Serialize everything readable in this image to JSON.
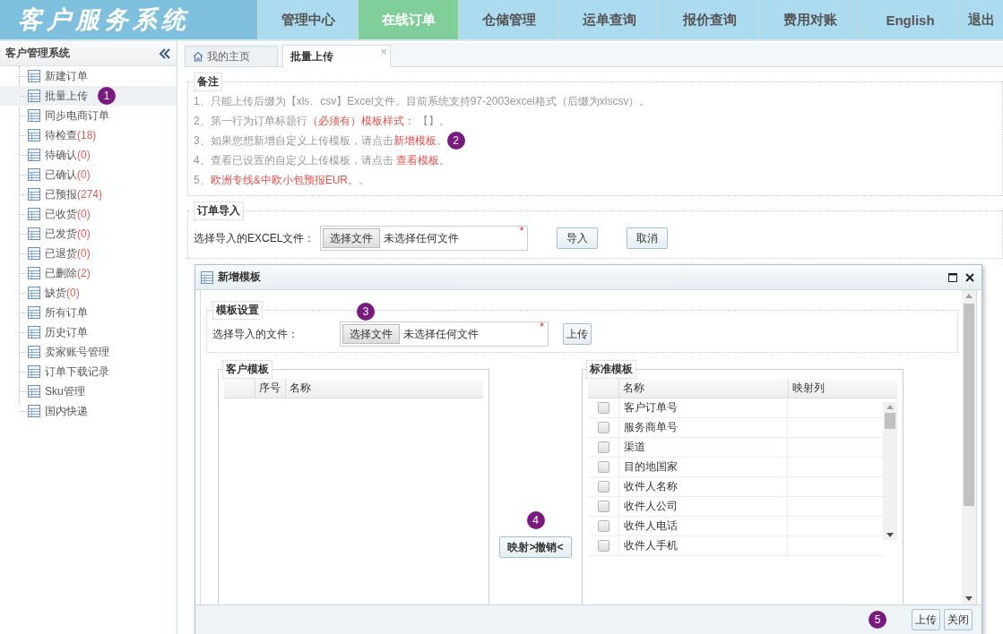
{
  "header": {
    "logo": "客户服务系统",
    "nav": [
      {
        "label": "管理中心",
        "selected": false
      },
      {
        "label": "在线订单",
        "selected": true
      },
      {
        "label": "仓储管理",
        "selected": false
      },
      {
        "label": "运单查询",
        "selected": false
      },
      {
        "label": "报价查询",
        "selected": false
      },
      {
        "label": "费用对账",
        "selected": false
      },
      {
        "label": "English",
        "selected": false
      },
      {
        "label": "退出",
        "selected": false
      }
    ]
  },
  "sidebar": {
    "title": "客户管理系统",
    "items": [
      {
        "label": "新建订单",
        "selected": false
      },
      {
        "label": "批量上传",
        "selected": true,
        "marker": "1"
      },
      {
        "label": "同步电商订单",
        "selected": false
      },
      {
        "label": "待检查",
        "count": "(18)",
        "selected": false
      },
      {
        "label": "待确认",
        "count": "(0)",
        "selected": false
      },
      {
        "label": "已确认",
        "count": "(0)",
        "selected": false
      },
      {
        "label": "已预报",
        "count": "(274)",
        "selected": false
      },
      {
        "label": "已收货",
        "count": "(0)",
        "selected": false
      },
      {
        "label": "已发货",
        "count": "(0)",
        "selected": false
      },
      {
        "label": "已退货",
        "count": "(0)",
        "selected": false
      },
      {
        "label": "已删除",
        "count": "(2)",
        "selected": false
      },
      {
        "label": "缺货",
        "count": "(0)",
        "selected": false
      },
      {
        "label": "所有订单",
        "selected": false
      },
      {
        "label": "历史订单",
        "selected": false
      },
      {
        "label": "卖家账号管理",
        "selected": false
      },
      {
        "label": "订单下载记录",
        "selected": false
      },
      {
        "label": "Sku管理",
        "selected": false
      },
      {
        "label": "国内快递",
        "selected": false
      }
    ]
  },
  "tabs": [
    {
      "label": "我的主页",
      "kind": "home",
      "selected": false
    },
    {
      "label": "批量上传",
      "kind": "plain",
      "selected": true,
      "close_label": "×"
    }
  ],
  "notes": {
    "legend": "备注",
    "lines": [
      {
        "segments": [
          {
            "kind": "plain",
            "text": "1、只能上传后缀为【xls、csv】Excel文件。目前系统支持97-2003excel格式（后缀为xlscsv）。"
          }
        ]
      },
      {
        "segments": [
          {
            "kind": "plain",
            "text": "2、第一行为订单标题行"
          },
          {
            "kind": "emphasis",
            "text": "（必须有）模板样式："
          },
          {
            "kind": "plain",
            "text": " 【】。"
          }
        ]
      },
      {
        "segments": [
          {
            "kind": "plain",
            "text": "3、如果您想新增自定义上传模板，请点击"
          },
          {
            "kind": "link",
            "text": "新增模板"
          },
          {
            "kind": "plain",
            "text": "。"
          }
        ],
        "marker": "2"
      },
      {
        "segments": [
          {
            "kind": "plain",
            "text": "4、查看已设置的自定义上传模板，请点击 "
          },
          {
            "kind": "link",
            "text": "查看模板"
          },
          {
            "kind": "plain",
            "text": "。"
          }
        ]
      },
      {
        "segments": [
          {
            "kind": "plain",
            "text": "5、"
          },
          {
            "kind": "emphasis",
            "text": "欧洲专线&中欧小包预报EUR。"
          },
          {
            "kind": "plain",
            "text": "。"
          }
        ]
      }
    ]
  },
  "order_import": {
    "legend": "订单导入",
    "label": "选择导入的EXCEL文件：",
    "file_button": "选择文件",
    "file_status": "未选择任何文件",
    "required_mark": "*",
    "buttons": [
      "导入",
      "取消"
    ]
  },
  "dialog": {
    "title": "新增模板",
    "settings": {
      "legend": "模板设置",
      "marker": "3",
      "label": "选择导入的文件：",
      "file_button": "选择文件",
      "file_status": "未选择任何文件",
      "required_mark": "*",
      "upload_button": "上传"
    },
    "customer_template": {
      "legend": "客户模板",
      "columns": [
        "序号",
        "名称"
      ]
    },
    "map": {
      "marker": "4",
      "button": "映射>撤销<"
    },
    "standard_template": {
      "legend": "标准模板",
      "columns": [
        "名称",
        "映射列"
      ],
      "rows": [
        {
          "name": "客户订单号",
          "checked": false
        },
        {
          "name": "服务商单号",
          "checked": false
        },
        {
          "name": "渠道",
          "checked": false
        },
        {
          "name": "目的地国家",
          "checked": false
        },
        {
          "name": "收件人名称",
          "checked": false
        },
        {
          "name": "收件人公司",
          "checked": false
        },
        {
          "name": "收件人电话",
          "checked": false
        },
        {
          "name": "收件人手机",
          "checked": false
        }
      ]
    },
    "footer": {
      "marker": "5",
      "buttons": [
        "上传",
        "关闭"
      ]
    }
  }
}
